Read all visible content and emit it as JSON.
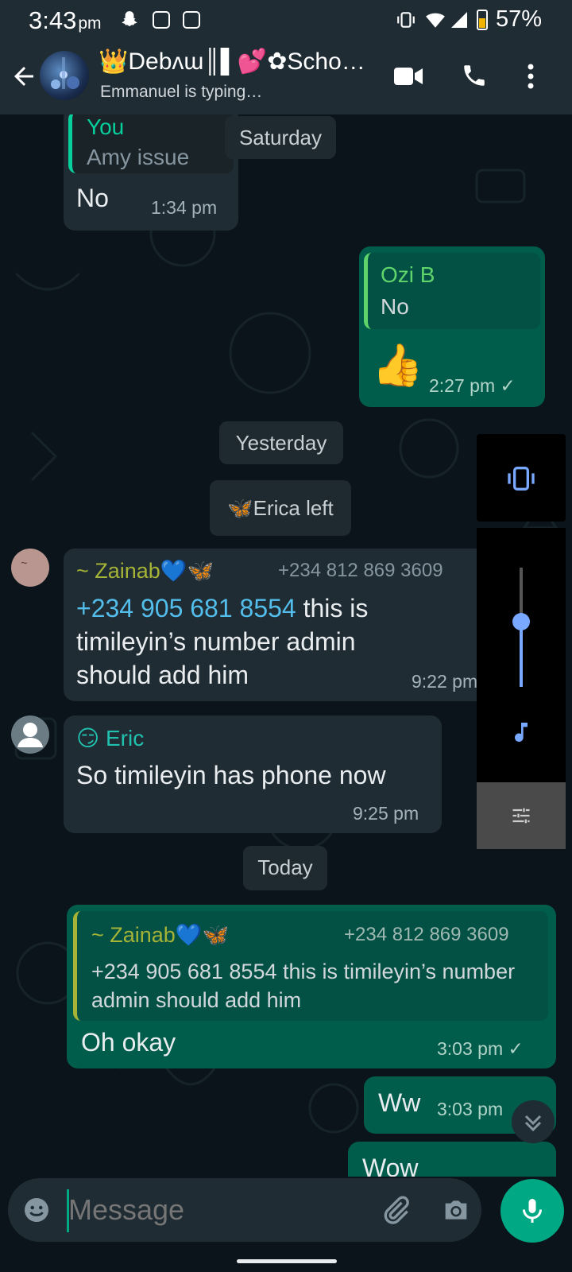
{
  "status_bar": {
    "time": "3:43",
    "ampm": "pm",
    "battery_percent": "57%"
  },
  "header": {
    "group_name": "👑Dеbʌɯ║▌💕✿Scho…",
    "subtitle": "Emmanuel is typing…"
  },
  "chat": {
    "msg1": {
      "quote_sender": "You",
      "quote_text": "Amy issue",
      "text": "No",
      "time": "1:34 pm"
    },
    "day_saturday": "Saturday",
    "msg2": {
      "quote_sender": "Ozi B",
      "quote_text": "No",
      "emoji": "👍",
      "time": "2:27 pm",
      "tick": "✓"
    },
    "day_yesterday": "Yesterday",
    "system_left": "🦋Erica left",
    "msg3": {
      "sender": "~ Zainab💙🦋",
      "sender_phone": "+234 812 869 3609",
      "link_number": "+234 905 681 8554",
      "text_rest": " this is timileyin’s number admin should add him",
      "time": "9:22 pm"
    },
    "msg4": {
      "sender": "😏 Eric",
      "text": "So timileyin has phone now",
      "time": "9:25 pm"
    },
    "day_today": "Today",
    "msg5": {
      "quote_sender": "~ Zainab💙🦋",
      "quote_phone": "+234 812 869 3609",
      "quote_text": "+234 905 681 8554 this is timileyin’s number admin should add him",
      "text": "Oh okay",
      "time": "3:03 pm",
      "tick": "✓"
    },
    "msg6": {
      "text": "Ww",
      "time": "3:03 pm"
    },
    "msg7_partial": "Wow"
  },
  "volume_panel": {
    "level": 0.55
  },
  "input": {
    "placeholder": "Message"
  },
  "colors": {
    "accent": "#00a884",
    "incoming": "#202c33",
    "outgoing": "#005c4b",
    "link": "#53bdeb",
    "zainab": "#a5b337",
    "eric": "#21c1b0",
    "you": "#06cf9c",
    "ozi": "#5fd46b"
  }
}
